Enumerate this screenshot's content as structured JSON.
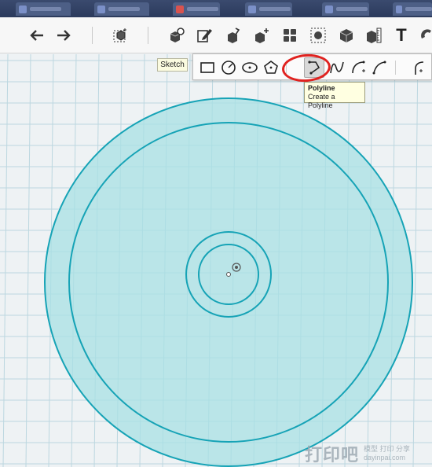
{
  "browser_tabs": [
    {
      "icon": "page-icon"
    },
    {
      "icon": "page-icon"
    },
    {
      "icon": "page-icon"
    },
    {
      "icon": "red-icon"
    },
    {
      "icon": "page-icon"
    },
    {
      "icon": "page-icon"
    },
    {
      "icon": "page-icon"
    }
  ],
  "toolbar": {
    "tools": [
      {
        "name": "undo-button",
        "icon": "undo-arrow-icon"
      },
      {
        "name": "redo-button",
        "icon": "redo-arrow-icon"
      },
      {
        "name": "transform-button",
        "icon": "transform-box-icon"
      },
      {
        "name": "primitives-button",
        "icon": "primitive-shapes-icon"
      },
      {
        "name": "sketch-button",
        "icon": "sketch-pencil-icon"
      },
      {
        "name": "construct-button",
        "icon": "construct-extrude-icon"
      },
      {
        "name": "modify-button",
        "icon": "modify-tweak-icon"
      },
      {
        "name": "pattern-button",
        "icon": "pattern-grid-icon"
      },
      {
        "name": "grouping-button",
        "icon": "group-ungroup-icon"
      },
      {
        "name": "combine-button",
        "icon": "combine-solid-icon"
      },
      {
        "name": "measure-button",
        "icon": "measure-ruler-icon"
      },
      {
        "name": "text-button",
        "icon": "text-t-icon"
      },
      {
        "name": "snap-button",
        "icon": "snap-magnet-icon"
      }
    ],
    "text_tool_glyph": "T"
  },
  "sketch": {
    "label": "Sketch",
    "tools": [
      {
        "name": "rectangle-tool",
        "icon": "rectangle-icon"
      },
      {
        "name": "circle-tool",
        "icon": "circle-icon"
      },
      {
        "name": "ellipse-tool",
        "icon": "ellipse-icon"
      },
      {
        "name": "polygon-tool",
        "icon": "polygon-icon"
      },
      {
        "name": "polyline-tool",
        "icon": "polyline-icon",
        "active": true
      },
      {
        "name": "spline-tool",
        "icon": "spline-icon"
      },
      {
        "name": "two-point-arc-tool",
        "icon": "two-point-arc-icon"
      },
      {
        "name": "three-point-arc-tool",
        "icon": "three-point-arc-icon"
      },
      {
        "name": "fillet-tool",
        "icon": "fillet-icon"
      }
    ],
    "highlighted_tool": "polyline-tool"
  },
  "tooltip": {
    "title": "Polyline",
    "description": "Create a Polyline"
  },
  "watermark": {
    "big": "打印吧",
    "line1": "模型 打印 分享",
    "line2": "dayinpai.com"
  },
  "colors": {
    "grid_line": "#bcd7e0",
    "grid_bg": "#eef2f4",
    "sketch_fill": "#a8e0e4",
    "sketch_stroke": "#16a3b6",
    "highlight_circle": "#e0221f",
    "tooltip_bg": "#ffffe1"
  }
}
